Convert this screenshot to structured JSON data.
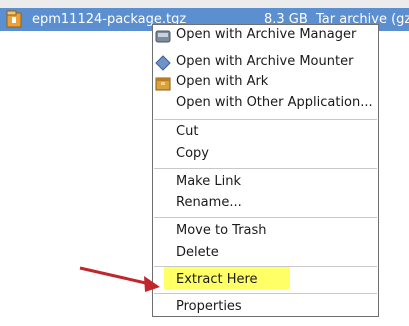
{
  "file": {
    "name": "epm11124-package.tgz",
    "size": "8.3 GB",
    "type": "Tar archive (gzip",
    "icon": "archive-file-icon"
  },
  "menu": {
    "items": [
      {
        "label": "Open with Archive Manager",
        "icon": "archive-manager-icon"
      },
      {
        "label": "Open with Archive Mounter",
        "icon": "diamond-icon"
      },
      {
        "label": "Open with Ark",
        "icon": "ark-icon"
      },
      {
        "label": "Open with Other Application..."
      },
      {
        "label": "Cut"
      },
      {
        "label": "Copy"
      },
      {
        "label": "Make Link"
      },
      {
        "label": "Rename..."
      },
      {
        "label": "Move to Trash"
      },
      {
        "label": "Delete"
      },
      {
        "label": "Extract Here"
      },
      {
        "label": "Properties"
      }
    ],
    "highlight_color": "#ffff66",
    "annotation_arrow_color": "#c0262b"
  }
}
